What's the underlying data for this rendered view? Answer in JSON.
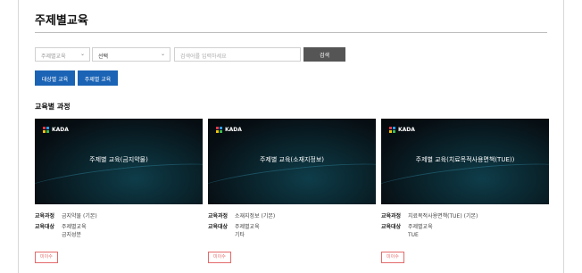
{
  "page": {
    "title": "주제별교육"
  },
  "filters": {
    "category_select": "주제별교육",
    "option_select": "선택",
    "search_placeholder": "검색어를 입력하세요",
    "search_button": "검색"
  },
  "tabs": [
    {
      "label": "대상별 교육"
    },
    {
      "label": "주제별 교육"
    }
  ],
  "section": {
    "title": "교육별 과정"
  },
  "labels": {
    "course": "교육과정",
    "target": "교육대상"
  },
  "brand": {
    "logo_text": "KADA"
  },
  "cards": [
    {
      "thumb_title": "주제별 교육(금지약물)",
      "course": "금지약물 (기본)",
      "target": "주제별교육",
      "target_sub": "금지성분",
      "status": "미이수"
    },
    {
      "thumb_title": "주제별 교육(소재지정보)",
      "course": "소재지정보 (기본)",
      "target": "주제별교육",
      "target_sub": "기타",
      "status": "미이수"
    },
    {
      "thumb_title": "주제별 교육(치료목적사용면책(TUE))",
      "course": "치료목적사용면책(TUE) (기본)",
      "target": "주제별교육",
      "target_sub": "TUE",
      "status": "미이수"
    }
  ],
  "colors": {
    "accent": "#1a63b5",
    "button_dark": "#555555",
    "status": "#e46a6a"
  }
}
